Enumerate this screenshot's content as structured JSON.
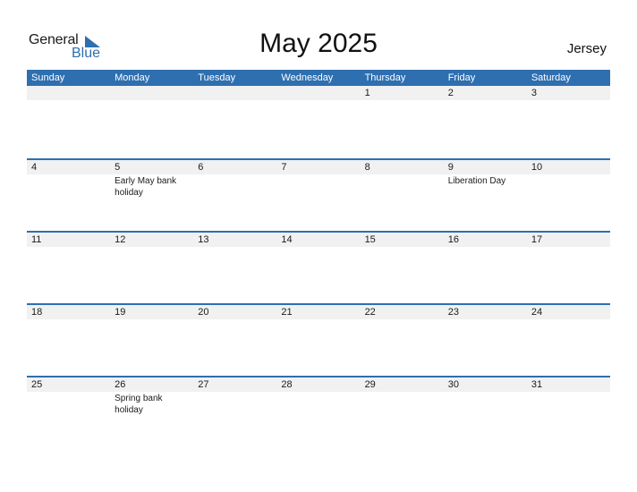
{
  "logo": {
    "general": "General",
    "blue": "Blue"
  },
  "title": "May 2025",
  "country": "Jersey",
  "colors": {
    "accent": "#2e6fb0",
    "date_row_bg": "#f1f1f1"
  },
  "weekdays": [
    "Sunday",
    "Monday",
    "Tuesday",
    "Wednesday",
    "Thursday",
    "Friday",
    "Saturday"
  ],
  "weeks": [
    {
      "days": [
        "",
        "",
        "",
        "",
        "1",
        "2",
        "3"
      ],
      "events": [
        "",
        "",
        "",
        "",
        "",
        "",
        ""
      ]
    },
    {
      "days": [
        "4",
        "5",
        "6",
        "7",
        "8",
        "9",
        "10"
      ],
      "events": [
        "",
        "Early May bank holiday",
        "",
        "",
        "",
        "Liberation Day",
        ""
      ]
    },
    {
      "days": [
        "11",
        "12",
        "13",
        "14",
        "15",
        "16",
        "17"
      ],
      "events": [
        "",
        "",
        "",
        "",
        "",
        "",
        ""
      ]
    },
    {
      "days": [
        "18",
        "19",
        "20",
        "21",
        "22",
        "23",
        "24"
      ],
      "events": [
        "",
        "",
        "",
        "",
        "",
        "",
        ""
      ]
    },
    {
      "days": [
        "25",
        "26",
        "27",
        "28",
        "29",
        "30",
        "31"
      ],
      "events": [
        "",
        "Spring bank holiday",
        "",
        "",
        "",
        "",
        ""
      ]
    }
  ]
}
